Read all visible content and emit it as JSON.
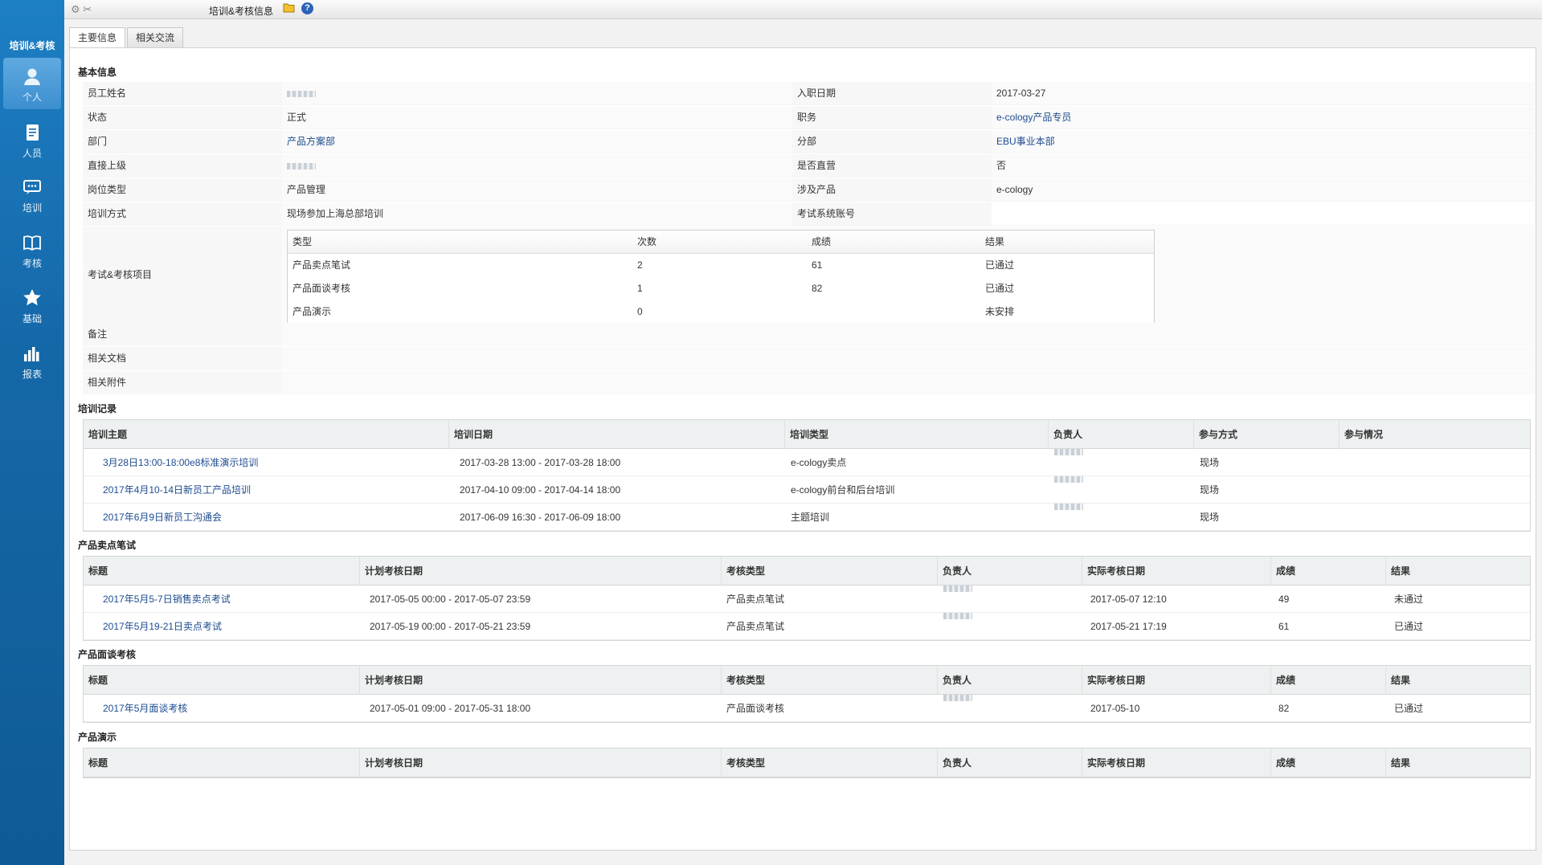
{
  "sidebar": {
    "brand": "培训&考核",
    "items": [
      {
        "label": "个人",
        "icon": "person-icon"
      },
      {
        "label": "人员",
        "icon": "document-icon"
      },
      {
        "label": "培训",
        "icon": "chat-icon"
      },
      {
        "label": "考核",
        "icon": "book-icon"
      },
      {
        "label": "基础",
        "icon": "star-icon"
      },
      {
        "label": "报表",
        "icon": "bar-chart-icon"
      }
    ]
  },
  "topbar": {
    "title": "培训&考核信息"
  },
  "tabs": [
    "主要信息",
    "相关交流"
  ],
  "basic": {
    "section": "基本信息",
    "rows": [
      {
        "l1": "员工姓名",
        "v1": "",
        "l2": "入职日期",
        "v2": "2017-03-27"
      },
      {
        "l1": "状态",
        "v1": "正式",
        "l2": "职务",
        "v2": "e-cology产品专员"
      },
      {
        "l1": "部门",
        "v1": "产品方案部",
        "l2": "分部",
        "v2": "EBU事业本部"
      },
      {
        "l1": "直接上级",
        "v1": "",
        "l2": "是否直营",
        "v2": "否"
      },
      {
        "l1": "岗位类型",
        "v1": "产品管理",
        "l2": "涉及产品",
        "v2": "e-cology"
      },
      {
        "l1": "培训方式",
        "v1": "现场参加上海总部培训",
        "l2": "考试系统账号",
        "v2": ""
      }
    ],
    "exam_label": "考试&考核项目",
    "exam_headers": [
      "类型",
      "次数",
      "成绩",
      "结果"
    ],
    "exam_rows": [
      [
        "产品卖点笔试",
        "2",
        "61",
        "已通过"
      ],
      [
        "产品面谈考核",
        "1",
        "82",
        "已通过"
      ],
      [
        "产品演示",
        "0",
        "",
        "未安排"
      ]
    ],
    "remark": "备注",
    "docs": "相关文档",
    "attachments": "相关附件"
  },
  "training": {
    "section": "培训记录",
    "headers": [
      "培训主题",
      "培训日期",
      "培训类型",
      "负责人",
      "参与方式",
      "参与情况"
    ],
    "rows": [
      [
        "3月28日13:00-18:00e8标准演示培训",
        "2017-03-28 13:00 - 2017-03-28 18:00",
        "e-cology卖点",
        "",
        "现场",
        ""
      ],
      [
        "2017年4月10-14日新员工产品培训",
        "2017-04-10 09:00 - 2017-04-14 18:00",
        "e-cology前台和后台培训",
        "",
        "现场",
        ""
      ],
      [
        "2017年6月9日新员工沟通会",
        "2017-06-09 16:30 - 2017-06-09 18:00",
        "主题培训",
        "",
        "现场",
        ""
      ]
    ]
  },
  "written": {
    "section": "产品卖点笔试",
    "headers": [
      "标题",
      "计划考核日期",
      "考核类型",
      "负责人",
      "实际考核日期",
      "成绩",
      "结果"
    ],
    "rows": [
      [
        "2017年5月5-7日销售卖点考试",
        "2017-05-05 00:00 - 2017-05-07 23:59",
        "产品卖点笔试",
        "",
        "2017-05-07 12:10",
        "49",
        "未通过"
      ],
      [
        "2017年5月19-21日卖点考试",
        "2017-05-19 00:00 - 2017-05-21 23:59",
        "产品卖点笔试",
        "",
        "2017-05-21 17:19",
        "61",
        "已通过"
      ]
    ]
  },
  "interview": {
    "section": "产品面谈考核",
    "headers": [
      "标题",
      "计划考核日期",
      "考核类型",
      "负责人",
      "实际考核日期",
      "成绩",
      "结果"
    ],
    "rows": [
      [
        "2017年5月面谈考核",
        "2017-05-01 09:00 - 2017-05-31 18:00",
        "产品面谈考核",
        "",
        "2017-05-10",
        "82",
        "已通过"
      ]
    ]
  },
  "demo": {
    "section": "产品演示",
    "headers": [
      "标题",
      "计划考核日期",
      "考核类型",
      "负责人",
      "实际考核日期",
      "成绩",
      "结果"
    ]
  }
}
